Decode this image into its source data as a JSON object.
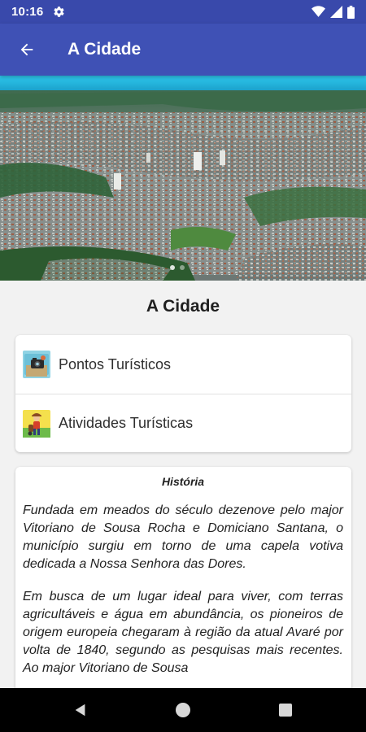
{
  "status": {
    "time": "10:16"
  },
  "app_bar": {
    "title": "A Cidade"
  },
  "hero": {
    "alt": "Aerial view of the city"
  },
  "page_heading": "A Cidade",
  "menu": [
    {
      "label": "Pontos Turísticos",
      "icon": "tourist-spots-icon"
    },
    {
      "label": "Atividades Turísticas",
      "icon": "tourist-activities-icon"
    }
  ],
  "history": {
    "title": "História",
    "paragraphs": [
      "Fundada em meados do século dezenove pelo major Vitoriano de Sousa Rocha e Domiciano Santana, o município surgiu em torno de uma capela votiva dedicada a Nossa Senhora das Dores.",
      "Em busca de um lugar ideal para viver, com terras agricultáveis e água em abundância, os pioneiros de origem europeia chegaram à região da atual Avaré por volta de 1840, segundo as pesquisas mais recentes. Ao major Vitoriano de Sousa"
    ]
  },
  "colors": {
    "primary": "#3f51b5",
    "status_bar": "#3949ab",
    "background": "#f2f2f2"
  }
}
